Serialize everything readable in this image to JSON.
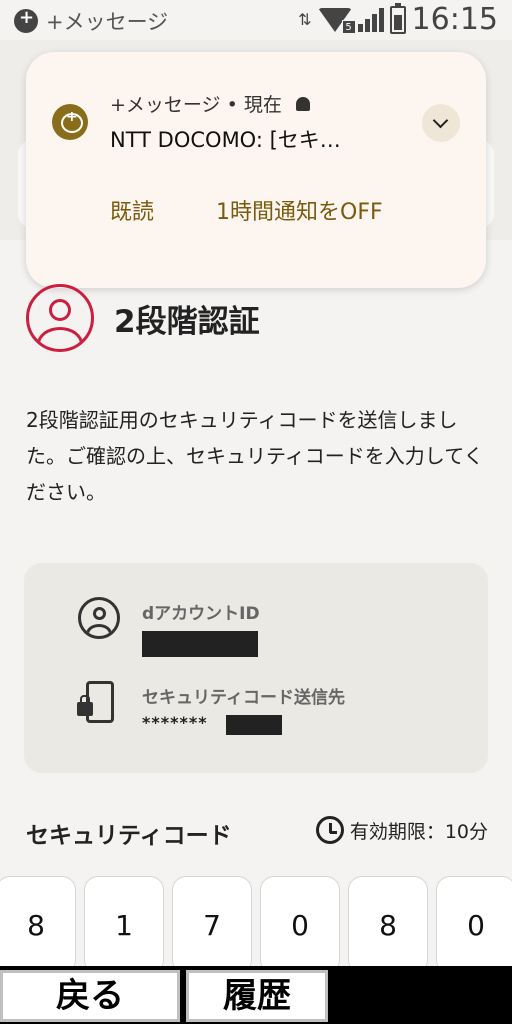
{
  "status_bar": {
    "app_label": "+メッセージ",
    "network_badge": "5",
    "time": "16:15"
  },
  "notification": {
    "app_name_time": "+メッセージ • 現在",
    "title": "NTT DOCOMO: [セキ…",
    "actions": {
      "read": "既読",
      "mute": "1時間通知をOFF"
    },
    "accent_color": "#8a6d1a"
  },
  "main": {
    "title": "2段階認証",
    "description": "2段階認証用のセキュリティコードを送信しました。ご確認の上、セキュリティコードを入力してください。",
    "account": {
      "id_label": "dアカウントID",
      "dest_label": "セキュリティコード送信先",
      "dest_masked": "*******"
    },
    "code_label": "セキュリティコード",
    "expiry": "有効期限：10分",
    "digits": [
      "8",
      "1",
      "7",
      "0",
      "8",
      "0"
    ],
    "icon_color": "#cc1f3f"
  },
  "softkeys": {
    "back": "戻る",
    "history": "履歴"
  }
}
